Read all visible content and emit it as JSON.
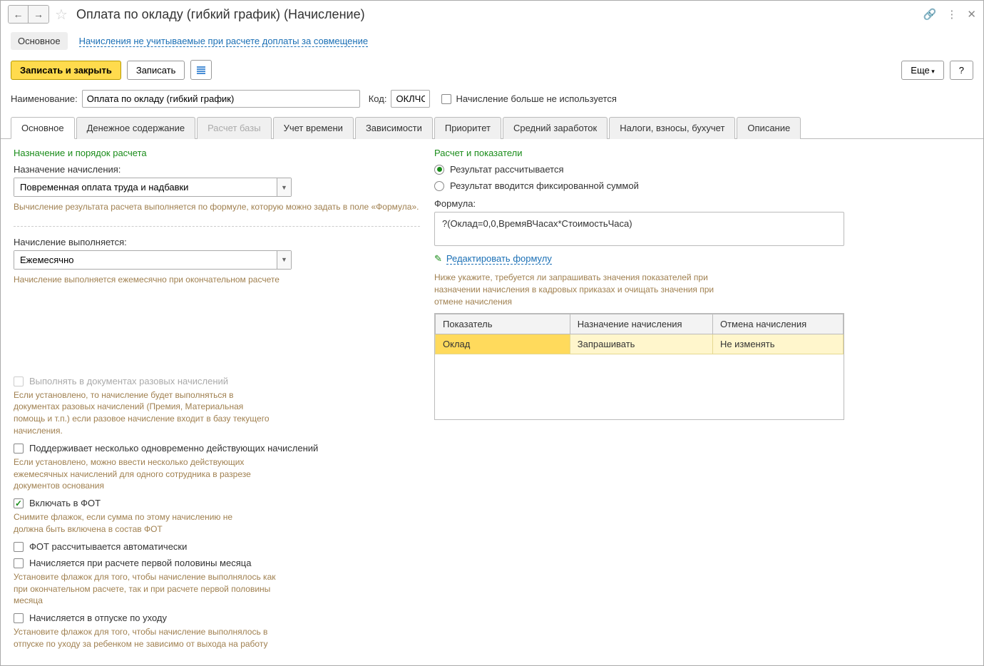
{
  "titlebar": {
    "title": "Оплата по окладу (гибкий график) (Начисление)"
  },
  "subheader": {
    "main": "Основное",
    "link": "Начисления не учитываемые при расчете доплаты за совмещение"
  },
  "toolbar": {
    "save_close": "Записать и закрыть",
    "save": "Записать",
    "more": "Еще",
    "help": "?"
  },
  "form": {
    "name_label": "Наименование:",
    "name_value": "Оплата по окладу (гибкий график)",
    "code_label": "Код:",
    "code_value": "ОКЛЧС",
    "not_used_label": "Начисление больше не используется"
  },
  "tabs": {
    "items": [
      {
        "label": "Основное"
      },
      {
        "label": "Денежное содержание"
      },
      {
        "label": "Расчет базы"
      },
      {
        "label": "Учет времени"
      },
      {
        "label": "Зависимости"
      },
      {
        "label": "Приоритет"
      },
      {
        "label": "Средний заработок"
      },
      {
        "label": "Налоги, взносы, бухучет"
      },
      {
        "label": "Описание"
      }
    ]
  },
  "left": {
    "section1_title": "Назначение и порядок расчета",
    "purpose_label": "Назначение начисления:",
    "purpose_value": "Повременная оплата труда и надбавки",
    "purpose_hint": "Вычисление результата расчета выполняется по формуле, которую можно задать в поле «Формула».",
    "execution_label": "Начисление выполняется:",
    "execution_value": "Ежемесячно",
    "execution_hint": "Начисление выполняется ежемесячно при окончательном расчете",
    "onetime_label": "Выполнять в документах разовых начислений",
    "onetime_hint": "Если установлено, то начисление будет выполняться в документах разовых начислений (Премия, Материальная помощь и т.п.) если разовое начисление входит в базу текущего начисления.",
    "multi_label": "Поддерживает несколько одновременно действующих начислений",
    "multi_hint": "Если установлено, можно ввести несколько действующих ежемесячных начислений для одного сотрудника в разрезе документов основания",
    "fot_label": "Включать в ФОТ",
    "fot_hint": "Снимите флажок, если сумма по этому начислению не должна быть включена в состав ФОТ",
    "fot_auto_label": "ФОТ рассчитывается автоматически",
    "firsthalf_label": "Начисляется при расчете первой половины месяца",
    "firsthalf_hint": "Установите флажок для того, чтобы начисление выполнялось как при окончательном расчете, так и при расчете первой половины месяца",
    "leave_label": "Начисляется в отпуске по уходу",
    "leave_hint": "Установите флажок для того, чтобы начисление выполнялось в отпуске по уходу за ребенком не зависимо от выхода на работу"
  },
  "right": {
    "section_title": "Расчет и показатели",
    "radio1": "Результат рассчитывается",
    "radio2": "Результат вводится фиксированной суммой",
    "formula_label": "Формула:",
    "formula_value": "?(Оклад=0,0,ВремяВЧасах*СтоимостьЧаса)",
    "edit_formula": "Редактировать формулу",
    "table_hint": "Ниже укажите, требуется ли запрашивать значения показателей при назначении начисления в кадровых приказах и очищать значения при отмене начисления",
    "table": {
      "headers": {
        "c1": "Показатель",
        "c2": "Назначение начисления",
        "c3": "Отмена начисления"
      },
      "row": {
        "c1": "Оклад",
        "c2": "Запрашивать",
        "c3": "Не изменять"
      }
    }
  }
}
